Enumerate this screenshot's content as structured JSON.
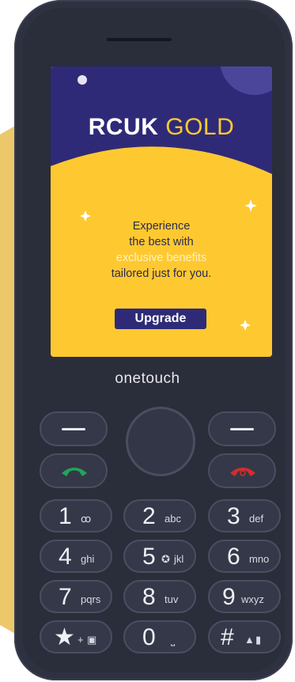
{
  "colors": {
    "phone_body": "#2e3140",
    "screen_gold": "#fec930",
    "screen_navy": "#2f2a78",
    "call_green": "#21a55a",
    "end_red": "#d42d2d"
  },
  "screen": {
    "brand_bold": "RCUK",
    "brand_light": "GOLD",
    "message_lines": [
      "Experience",
      "the best with",
      "exclusive benefits",
      "tailored just for you."
    ],
    "upgrade_label": "Upgrade"
  },
  "phone": {
    "brand_logo_a": "one",
    "brand_logo_b": "touch"
  },
  "keys": [
    {
      "digit": "1",
      "letters": "ꝏ",
      "icon": "voicemail-icon"
    },
    {
      "digit": "2",
      "letters": "abc"
    },
    {
      "digit": "3",
      "letters": "def"
    },
    {
      "digit": "4",
      "letters": "ghi"
    },
    {
      "digit": "5",
      "letters": "jkl",
      "icon": "flashlight-icon"
    },
    {
      "digit": "6",
      "letters": "mno"
    },
    {
      "digit": "7",
      "letters": "pqrs"
    },
    {
      "digit": "8",
      "letters": "tuv"
    },
    {
      "digit": "9",
      "letters": "wxyz"
    },
    {
      "digit": "*",
      "letters": "+",
      "icon": "lock-icon"
    },
    {
      "digit": "0",
      "letters": "⎵",
      "icon": "space-icon"
    },
    {
      "digit": "#",
      "letters": "",
      "icon": "shift-icon"
    }
  ]
}
